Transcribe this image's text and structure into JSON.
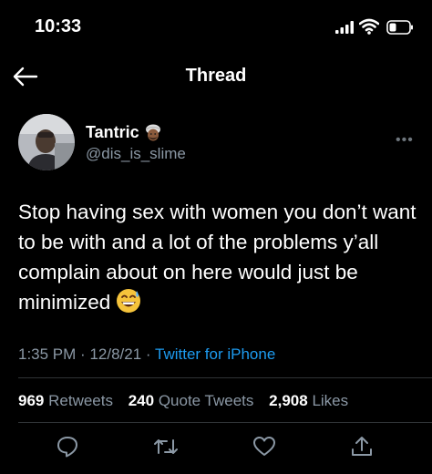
{
  "status_bar": {
    "time": "10:33"
  },
  "nav": {
    "title": "Thread"
  },
  "tweet": {
    "author_name": "Tantric",
    "author_handle": "@dis_is_slime",
    "text": "Stop having sex with women you don’t want to be with and a lot of the problems y’all complain about on here would just be minimized",
    "time": "1:35 PM",
    "date": "12/8/21",
    "separator": "·",
    "source": "Twitter for iPhone",
    "retweets_count": "969",
    "retweets_label": "Retweets",
    "quote_count": "240",
    "quote_label": "Quote Tweets",
    "likes_count": "2,908",
    "likes_label": "Likes"
  },
  "icons": {
    "back": "arrow-left-icon",
    "more": "more-dots-icon",
    "reply": "reply-icon",
    "retweet": "retweet-icon",
    "like": "heart-icon",
    "share": "share-icon"
  },
  "colors": {
    "background": "#000000",
    "link": "#1d9bf0",
    "secondary_text": "#8b98a5"
  }
}
